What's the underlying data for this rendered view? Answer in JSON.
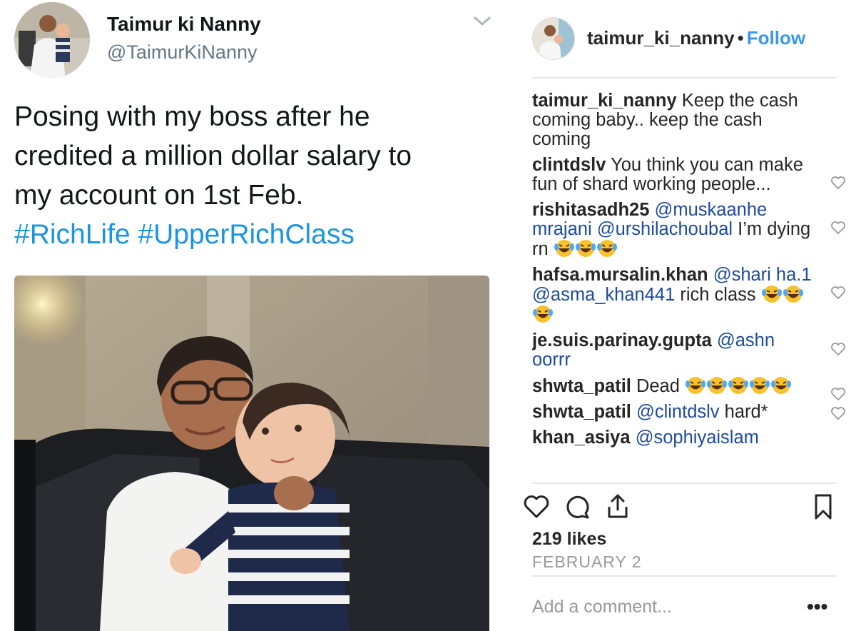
{
  "tweet": {
    "display_name": "Taimur ki Nanny",
    "handle": "@TaimurKiNanny",
    "text_lines": [
      "Posing with my boss after he",
      "credited a million dollar salary to",
      "my account on 1st Feb."
    ],
    "hashtags": "#RichLife #UpperRichClass",
    "menu_icon": "chevron-down-icon",
    "link_color": "#1b95e0"
  },
  "instagram": {
    "username": "taimur_ki_nanny",
    "separator": "•",
    "follow_label": "Follow",
    "follow_color": "#3897f0",
    "caption": {
      "user": "taimur_ki_nanny",
      "text": " Keep the cash coming baby.. keep the cash coming"
    },
    "comments": [
      {
        "user": "clintdslv",
        "text": " You think you can make fun of shard working people..."
      },
      {
        "user": "rishitasadh25",
        "mention1": "@muskaanhe mrajani",
        "mention2": "@urshilachoubal",
        "text": " I’m dying rn "
      },
      {
        "user": "hafsa.mursalin.khan",
        "mention1": "@shari ha.1",
        "mention2": "@asma_khan441",
        "text": " rich class "
      },
      {
        "user": "je.suis.parinay.gupta",
        "mention1": "@ashn oorrr"
      },
      {
        "user": "shwta_patil",
        "text": " Dead "
      },
      {
        "user": "shwta_patil",
        "mention1": "@clintdslv",
        "text": " hard*"
      },
      {
        "user": "khan_asiya",
        "mention1": "@sophiyaislam"
      }
    ],
    "likes": "219 likes",
    "date": "FEBRUARY 2",
    "add_comment_placeholder": "Add a comment...",
    "more_label": "•••",
    "icons": [
      "heart-icon",
      "comment-icon",
      "share-icon",
      "bookmark-icon",
      "laughing-emoji-icon"
    ]
  }
}
